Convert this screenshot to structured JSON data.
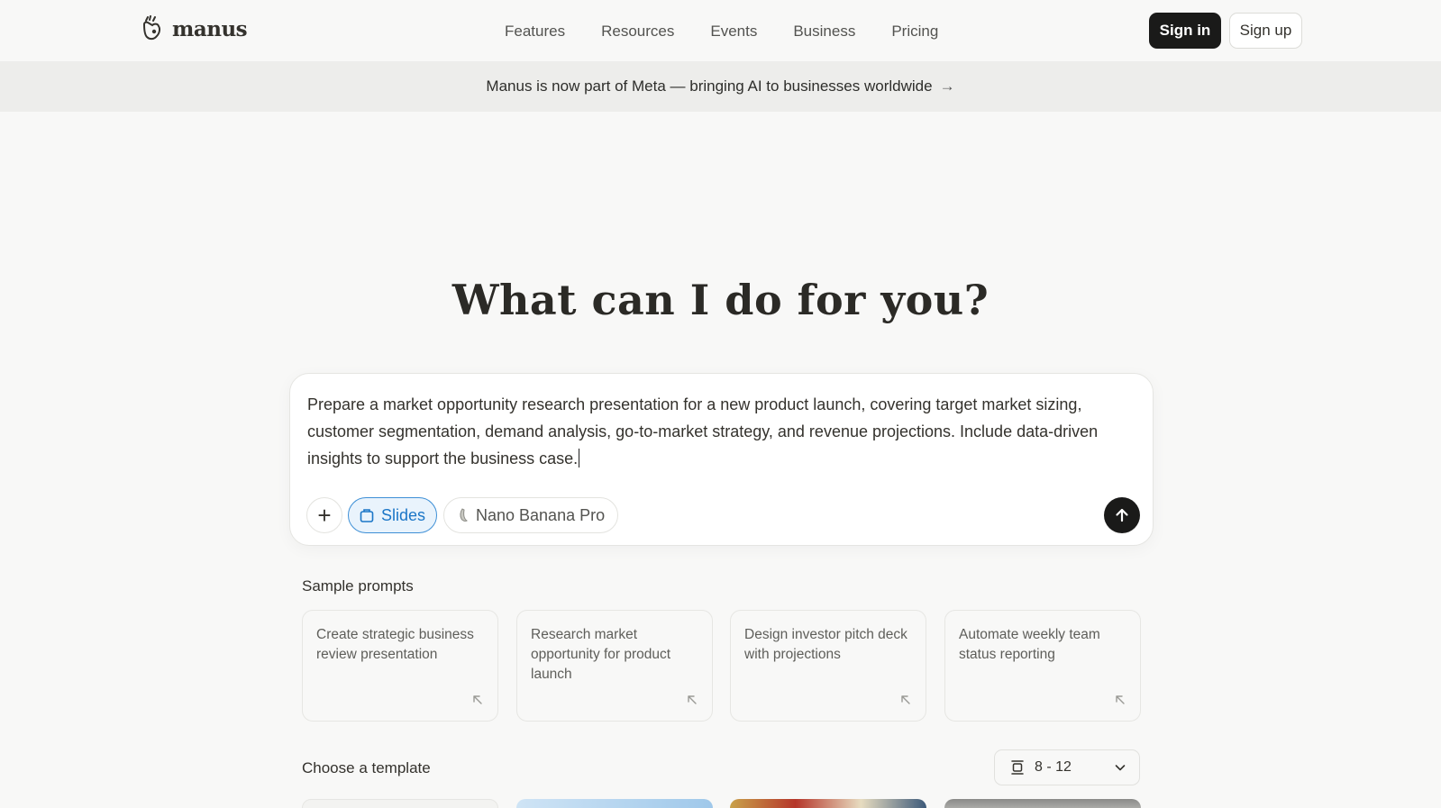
{
  "header": {
    "brand": "manus",
    "nav": [
      "Features",
      "Resources",
      "Events",
      "Business",
      "Pricing"
    ],
    "sign_in": "Sign in",
    "sign_up": "Sign up"
  },
  "banner": {
    "text": "Manus is now part of Meta — bringing AI to businesses worldwide",
    "arrow": "→"
  },
  "hero": {
    "title": "What can I do for you?"
  },
  "composer": {
    "value": "Prepare a market opportunity research presentation for a new product launch, covering target market sizing, customer segmentation, demand analysis, go-to-market strategy, and revenue projections. Include data-driven insights to support the business case.",
    "plus": "+",
    "mode_chip": "Slides",
    "model_chip": "Nano Banana Pro"
  },
  "sample_prompts": {
    "title": "Sample prompts",
    "items": [
      "Create strategic business review presentation",
      "Research market opportunity for product launch",
      "Design investor pitch deck with projections",
      "Automate weekly team status reporting"
    ]
  },
  "templates": {
    "title": "Choose a template",
    "slide_count": "8 - 12"
  },
  "colors": {
    "accent_blue": "#1b76c7",
    "button_dark": "#1a1a19",
    "background": "#f8f8f7"
  }
}
